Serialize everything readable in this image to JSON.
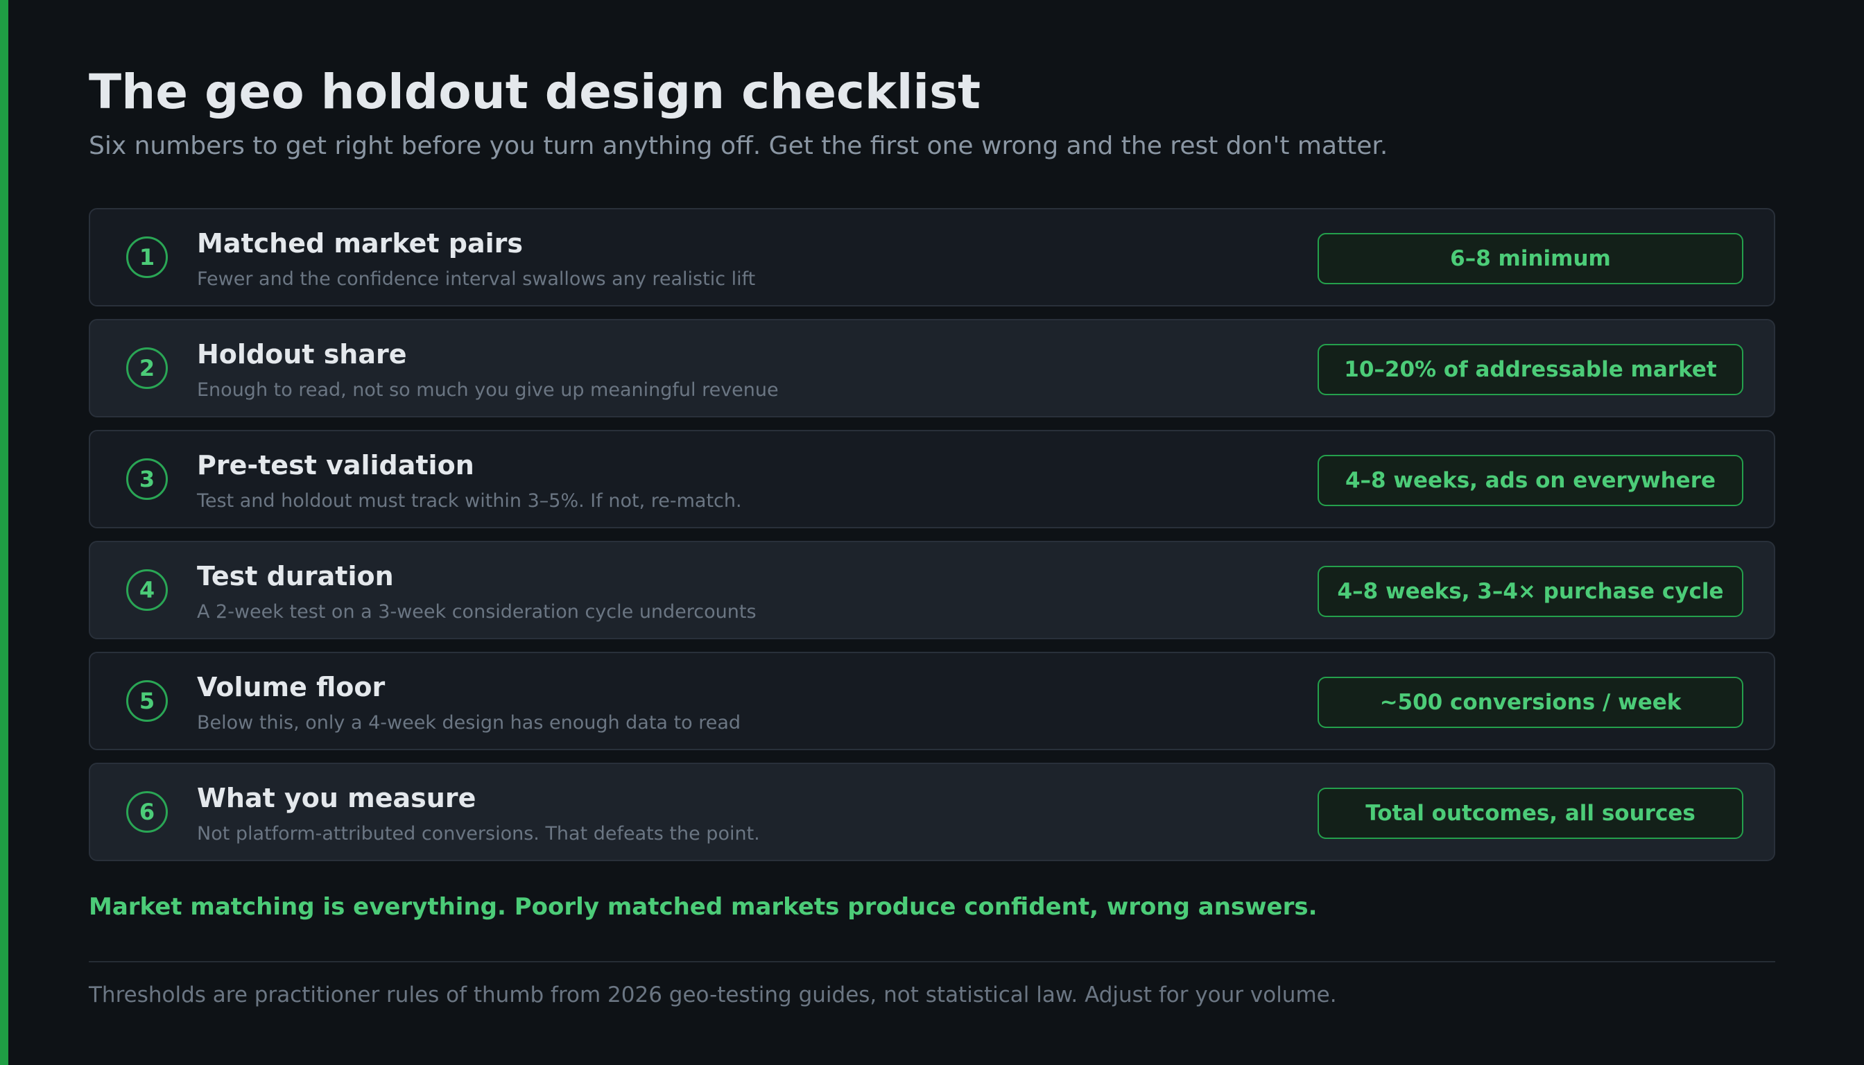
{
  "header": {
    "title": "The geo holdout design checklist",
    "subtitle": "Six numbers to get right before you turn anything off. Get the first one wrong and the rest don't matter."
  },
  "checklist": [
    {
      "number": "1",
      "title": "Matched market pairs",
      "description": "Fewer and the confidence interval swallows any realistic lift",
      "value": "6–8 minimum"
    },
    {
      "number": "2",
      "title": "Holdout share",
      "description": "Enough to read, not so much you give up meaningful revenue",
      "value": "10–20% of addressable market"
    },
    {
      "number": "3",
      "title": "Pre-test validation",
      "description": "Test and holdout must track within 3–5%. If not, re-match.",
      "value": "4–8 weeks, ads on everywhere"
    },
    {
      "number": "4",
      "title": "Test duration",
      "description": "A 2-week test on a 3-week consideration cycle undercounts",
      "value": "4–8 weeks, 3–4× purchase cycle"
    },
    {
      "number": "5",
      "title": "Volume floor",
      "description": "Below this, only a 4-week design has enough data to read",
      "value": "~500 conversions / week"
    },
    {
      "number": "6",
      "title": "What you measure",
      "description": "Not platform-attributed conversions. That defeats the point.",
      "value": "Total outcomes, all sources"
    }
  ],
  "callout": "Market matching is everything. Poorly matched markets produce confident, wrong answers.",
  "footnote": "Thresholds are practitioner rules of thumb from 2026 geo-testing guides, not statistical law. Adjust for your volume.",
  "colors": {
    "accent": "#4ccc78",
    "background": "#0e1216"
  }
}
